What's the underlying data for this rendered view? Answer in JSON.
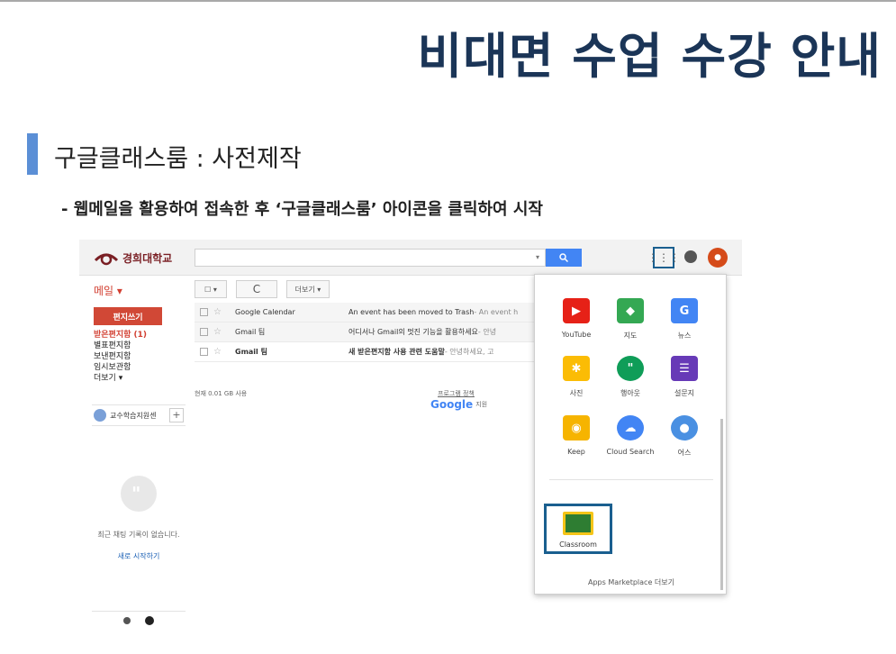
{
  "slide": {
    "title": "비대면 수업 수강 안내",
    "section_title": "구글클래스룸 : 사전제작",
    "instruction": "- 웹메일을 활용하여 접속한 후 ‘구글클래스룸’ 아이콘을 클릭하여 시작",
    "accent_color": "#5b8fd6",
    "title_color": "#1b3557"
  },
  "gmail": {
    "logo_text": "경희대학교",
    "search": {
      "value": "",
      "caret": "▾",
      "button_icon": "search-icon"
    },
    "mail_label": "메일 ▾",
    "compose_label": "편지쓰기",
    "folders": [
      "받은편지함 (1)",
      "별표편지함",
      "보낸편지함",
      "임시보관함",
      "더보기 ▾"
    ],
    "hangout_user": "교수학습지원센",
    "toolbar": {
      "select": "☐ ▾",
      "refresh": "C",
      "more": "더보기 ▾"
    },
    "mails": [
      {
        "sender": "Google Calendar",
        "subject": "An event has been moved to Trash",
        "snippet": " - An event h"
      },
      {
        "sender": "Gmail 팀",
        "subject": "어디서나 Gmail의 멋진 기능을 활용하세요",
        "snippet": " - 안녕"
      },
      {
        "sender": "Gmail 팀",
        "subject": "새 받은편지함 사용 관련 도움말",
        "snippet": " - 안녕하세요, 고"
      }
    ],
    "storage_text": "현재 0.01 GB 사용",
    "policy_link": "프로그램 정책",
    "powered_logo": "Google",
    "powered_suffix": "지원",
    "chat_empty": "최근 채팅 기록이 없습니다.",
    "chat_start": "새로 시작하기",
    "apps_menu": {
      "apps": [
        {
          "label": "YouTube",
          "icon": "youtube-icon",
          "color": "#e62117"
        },
        {
          "label": "지도",
          "icon": "maps-icon",
          "color": "#34a853"
        },
        {
          "label": "뉴스",
          "icon": "news-icon",
          "color": "#4285f4"
        },
        {
          "label": "사진",
          "icon": "photos-icon",
          "color": "#fbbc05"
        },
        {
          "label": "행아웃",
          "icon": "hangouts-icon",
          "color": "#0f9d58"
        },
        {
          "label": "설문지",
          "icon": "forms-icon",
          "color": "#673ab7"
        },
        {
          "label": "Keep",
          "icon": "keep-icon",
          "color": "#f6b400"
        },
        {
          "label": "Cloud Search",
          "icon": "cloud-search-icon",
          "color": "#4285f4"
        },
        {
          "label": "어스",
          "icon": "earth-icon",
          "color": "#4a90e2"
        }
      ],
      "classroom_label": "Classroom",
      "marketplace": "Apps Marketplace 더보기"
    }
  }
}
